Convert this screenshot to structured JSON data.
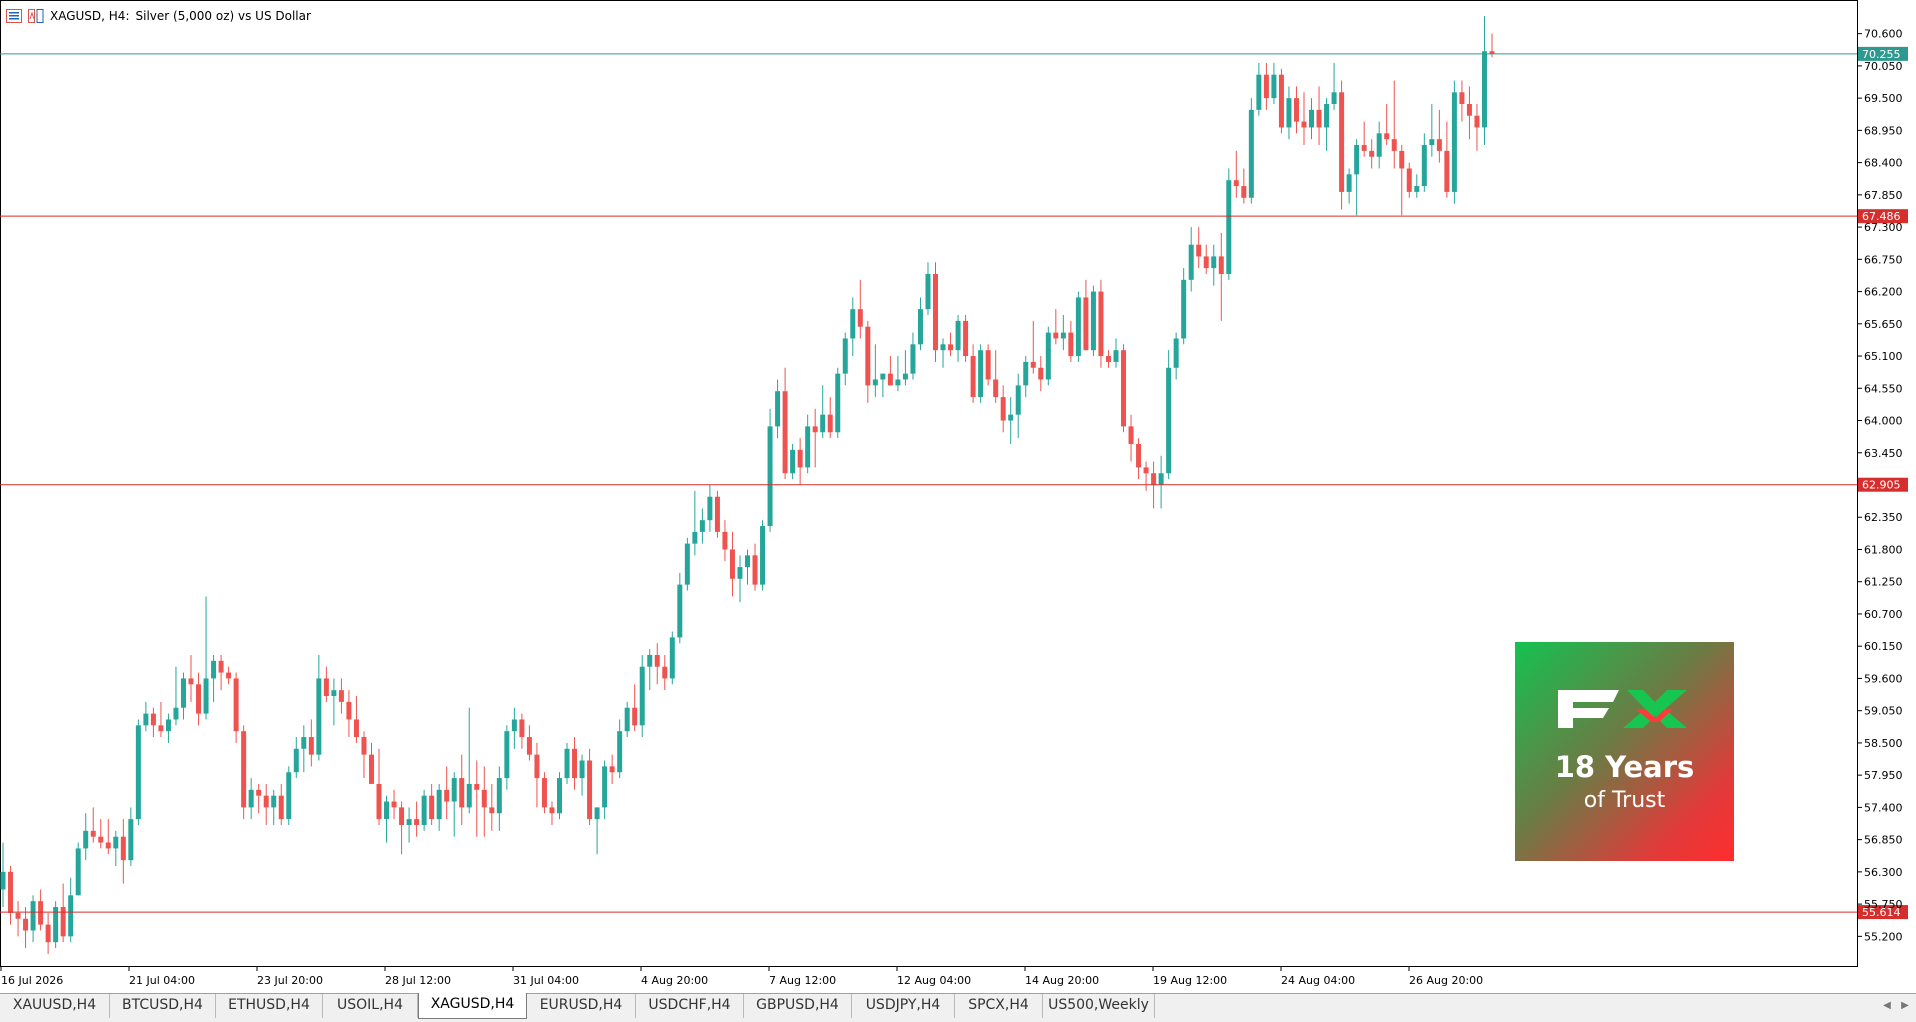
{
  "header": {
    "symbol": "XAGUSD, H4:",
    "description": "Silver (5,000 oz) vs US Dollar"
  },
  "colors": {
    "bull": "#26a69a",
    "bear": "#ef5350",
    "level": "#d62d2d",
    "current_line": "#2e9a8f"
  },
  "price_axis": {
    "ticks": [
      "70.600",
      "70.050",
      "69.500",
      "68.950",
      "68.400",
      "67.850",
      "67.300",
      "66.750",
      "66.200",
      "65.650",
      "65.100",
      "64.550",
      "64.000",
      "63.450",
      "62.350",
      "61.800",
      "61.250",
      "60.700",
      "60.150",
      "59.600",
      "59.050",
      "58.500",
      "57.950",
      "57.400",
      "56.850",
      "56.300",
      "55.750",
      "55.200"
    ]
  },
  "levels": [
    {
      "price": "67.486",
      "label": "67.486"
    },
    {
      "price": "62.905",
      "label": "62.905"
    },
    {
      "price": "55.614",
      "label": "55.614"
    }
  ],
  "current_price": "70.255",
  "time_axis": [
    "16 Jul 2026",
    "21 Jul 04:00",
    "23 Jul 20:00",
    "28 Jul 12:00",
    "31 Jul 04:00",
    "4 Aug 20:00",
    "7 Aug 12:00",
    "12 Aug 04:00",
    "14 Aug 20:00",
    "19 Aug 12:00",
    "24 Aug 04:00",
    "26 Aug 20:00"
  ],
  "logo": {
    "line1": "18 Years",
    "line2": "of Trust",
    "mark": "FX"
  },
  "tabs": [
    "XAUUSD,H4",
    "BTCUSD,H4",
    "ETHUSD,H4",
    "USOIL,H4",
    "XAGUSD,H4",
    "EURUSD,H4",
    "USDCHF,H4",
    "GBPUSD,H4",
    "USDJPY,H4",
    "SPCX,H4",
    "US500,Weekly"
  ],
  "active_tab": "XAGUSD,H4",
  "chart_data": {
    "type": "candlestick",
    "symbol": "XAGUSD",
    "timeframe": "H4",
    "ylim": [
      54.95,
      70.85
    ],
    "candles": [
      [
        56.0,
        56.8,
        55.7,
        56.3
      ],
      [
        56.3,
        56.4,
        55.4,
        55.6
      ],
      [
        55.6,
        55.8,
        55.2,
        55.5
      ],
      [
        55.5,
        55.7,
        55.0,
        55.3
      ],
      [
        55.3,
        55.9,
        55.1,
        55.8
      ],
      [
        55.8,
        56.0,
        55.3,
        55.4
      ],
      [
        55.4,
        55.6,
        54.9,
        55.1
      ],
      [
        55.1,
        55.8,
        55.0,
        55.7
      ],
      [
        55.7,
        56.1,
        55.1,
        55.2
      ],
      [
        55.2,
        56.2,
        55.1,
        55.9
      ],
      [
        55.9,
        56.8,
        55.9,
        56.7
      ],
      [
        56.7,
        57.3,
        56.5,
        57.0
      ],
      [
        57.0,
        57.4,
        56.8,
        56.9
      ],
      [
        56.9,
        57.2,
        56.7,
        56.8
      ],
      [
        56.8,
        57.2,
        56.6,
        56.7
      ],
      [
        56.7,
        57.0,
        56.4,
        56.9
      ],
      [
        56.9,
        57.2,
        56.1,
        56.5
      ],
      [
        56.5,
        57.4,
        56.4,
        57.2
      ],
      [
        57.2,
        58.9,
        57.1,
        58.8
      ],
      [
        58.8,
        59.2,
        58.7,
        59.0
      ],
      [
        59.0,
        59.1,
        58.6,
        58.8
      ],
      [
        58.8,
        59.2,
        58.6,
        58.7
      ],
      [
        58.7,
        59.0,
        58.5,
        58.9
      ],
      [
        58.9,
        59.8,
        58.8,
        59.1
      ],
      [
        59.1,
        59.7,
        58.9,
        59.6
      ],
      [
        59.6,
        60.0,
        59.2,
        59.5
      ],
      [
        59.5,
        59.7,
        58.8,
        59.0
      ],
      [
        59.0,
        61.0,
        58.9,
        59.6
      ],
      [
        59.6,
        60.0,
        59.2,
        59.9
      ],
      [
        59.9,
        60.0,
        59.4,
        59.7
      ],
      [
        59.7,
        59.8,
        59.5,
        59.6
      ],
      [
        59.6,
        59.7,
        58.5,
        58.7
      ],
      [
        58.7,
        58.8,
        57.2,
        57.4
      ],
      [
        57.4,
        57.9,
        57.2,
        57.7
      ],
      [
        57.7,
        57.8,
        57.3,
        57.6
      ],
      [
        57.6,
        57.8,
        57.1,
        57.4
      ],
      [
        57.4,
        57.7,
        57.1,
        57.6
      ],
      [
        57.6,
        57.8,
        57.1,
        57.2
      ],
      [
        57.2,
        58.1,
        57.1,
        58.0
      ],
      [
        58.0,
        58.6,
        57.9,
        58.4
      ],
      [
        58.4,
        58.8,
        58.0,
        58.6
      ],
      [
        58.6,
        58.9,
        58.1,
        58.3
      ],
      [
        58.3,
        60.0,
        58.2,
        59.6
      ],
      [
        59.6,
        59.8,
        59.2,
        59.3
      ],
      [
        59.3,
        59.6,
        58.8,
        59.4
      ],
      [
        59.4,
        59.6,
        59.0,
        59.2
      ],
      [
        59.2,
        59.4,
        58.6,
        58.9
      ],
      [
        58.9,
        59.3,
        58.5,
        58.6
      ],
      [
        58.6,
        58.7,
        57.9,
        58.3
      ],
      [
        58.3,
        58.5,
        57.9,
        57.8
      ],
      [
        57.8,
        58.4,
        57.1,
        57.2
      ],
      [
        57.2,
        57.6,
        56.8,
        57.5
      ],
      [
        57.5,
        57.7,
        57.2,
        57.4
      ],
      [
        57.4,
        57.5,
        56.6,
        57.1
      ],
      [
        57.1,
        57.4,
        56.8,
        57.2
      ],
      [
        57.2,
        57.5,
        56.9,
        57.1
      ],
      [
        57.1,
        57.7,
        57.0,
        57.6
      ],
      [
        57.6,
        57.8,
        57.1,
        57.2
      ],
      [
        57.2,
        57.8,
        57.0,
        57.7
      ],
      [
        57.7,
        58.1,
        57.2,
        57.5
      ],
      [
        57.5,
        58.0,
        56.9,
        57.9
      ],
      [
        57.9,
        58.3,
        57.1,
        57.4
      ],
      [
        57.4,
        59.1,
        57.3,
        57.8
      ],
      [
        57.8,
        58.2,
        56.9,
        57.7
      ],
      [
        57.7,
        58.1,
        56.9,
        57.4
      ],
      [
        57.4,
        57.8,
        57.0,
        57.3
      ],
      [
        57.3,
        58.1,
        57.0,
        57.9
      ],
      [
        57.9,
        58.8,
        57.7,
        58.7
      ],
      [
        58.7,
        59.1,
        58.4,
        58.9
      ],
      [
        58.9,
        59.0,
        58.4,
        58.6
      ],
      [
        58.6,
        58.8,
        58.2,
        58.3
      ],
      [
        58.3,
        58.5,
        57.4,
        57.9
      ],
      [
        57.9,
        58.0,
        57.3,
        57.4
      ],
      [
        57.4,
        57.5,
        57.1,
        57.3
      ],
      [
        57.3,
        58.0,
        57.2,
        57.9
      ],
      [
        57.9,
        58.5,
        57.8,
        58.4
      ],
      [
        58.4,
        58.6,
        57.7,
        57.9
      ],
      [
        57.9,
        58.3,
        57.6,
        58.2
      ],
      [
        58.2,
        58.4,
        57.1,
        57.2
      ],
      [
        57.2,
        57.4,
        56.6,
        57.4
      ],
      [
        57.4,
        58.2,
        57.2,
        58.1
      ],
      [
        58.1,
        58.3,
        57.8,
        58.0
      ],
      [
        58.0,
        58.9,
        57.9,
        58.7
      ],
      [
        58.7,
        59.2,
        58.6,
        59.1
      ],
      [
        59.1,
        59.5,
        58.7,
        58.8
      ],
      [
        58.8,
        60.0,
        58.6,
        59.8
      ],
      [
        59.8,
        60.1,
        59.4,
        60.0
      ],
      [
        60.0,
        60.2,
        59.5,
        59.8
      ],
      [
        59.8,
        60.0,
        59.4,
        59.6
      ],
      [
        59.6,
        60.4,
        59.5,
        60.3
      ],
      [
        60.3,
        61.4,
        60.2,
        61.2
      ],
      [
        61.2,
        62.0,
        61.1,
        61.9
      ],
      [
        61.9,
        62.8,
        61.7,
        62.1
      ],
      [
        62.1,
        62.5,
        61.9,
        62.3
      ],
      [
        62.3,
        62.9,
        62.1,
        62.7
      ],
      [
        62.7,
        62.8,
        62.0,
        62.1
      ],
      [
        62.1,
        62.3,
        61.6,
        61.8
      ],
      [
        61.8,
        62.1,
        61.0,
        61.3
      ],
      [
        61.3,
        61.7,
        60.9,
        61.5
      ],
      [
        61.5,
        61.8,
        61.2,
        61.7
      ],
      [
        61.7,
        61.9,
        61.1,
        61.2
      ],
      [
        61.2,
        62.3,
        61.1,
        62.2
      ],
      [
        62.2,
        64.2,
        62.1,
        63.9
      ],
      [
        63.9,
        64.7,
        63.7,
        64.5
      ],
      [
        64.5,
        64.9,
        63.0,
        63.1
      ],
      [
        63.1,
        63.6,
        63.0,
        63.5
      ],
      [
        63.5,
        63.7,
        62.9,
        63.2
      ],
      [
        63.2,
        64.1,
        63.1,
        63.9
      ],
      [
        63.9,
        64.2,
        63.2,
        63.8
      ],
      [
        63.8,
        64.6,
        63.7,
        64.1
      ],
      [
        64.1,
        64.4,
        63.7,
        63.8
      ],
      [
        63.8,
        64.9,
        63.7,
        64.8
      ],
      [
        64.8,
        65.5,
        64.6,
        65.4
      ],
      [
        65.4,
        66.1,
        65.1,
        65.9
      ],
      [
        65.9,
        66.4,
        65.4,
        65.6
      ],
      [
        65.6,
        65.7,
        64.3,
        64.6
      ],
      [
        64.6,
        65.3,
        64.4,
        64.7
      ],
      [
        64.7,
        64.8,
        64.4,
        64.8
      ],
      [
        64.8,
        65.1,
        64.6,
        64.6
      ],
      [
        64.6,
        65.1,
        64.5,
        64.7
      ],
      [
        64.7,
        65.2,
        64.6,
        64.8
      ],
      [
        64.8,
        65.5,
        64.7,
        65.3
      ],
      [
        65.3,
        66.1,
        65.2,
        65.9
      ],
      [
        65.9,
        66.7,
        65.8,
        66.5
      ],
      [
        66.5,
        66.7,
        65.0,
        65.2
      ],
      [
        65.2,
        65.4,
        64.9,
        65.3
      ],
      [
        65.3,
        65.5,
        65.1,
        65.2
      ],
      [
        65.2,
        65.8,
        65.0,
        65.7
      ],
      [
        65.7,
        65.8,
        65.0,
        65.1
      ],
      [
        65.1,
        65.3,
        64.3,
        64.4
      ],
      [
        64.4,
        65.3,
        64.3,
        65.2
      ],
      [
        65.2,
        65.3,
        64.6,
        64.7
      ],
      [
        64.7,
        65.2,
        64.3,
        64.4
      ],
      [
        64.4,
        64.6,
        63.8,
        64.0
      ],
      [
        64.0,
        64.4,
        63.6,
        64.1
      ],
      [
        64.1,
        64.8,
        63.7,
        64.6
      ],
      [
        64.6,
        65.1,
        64.4,
        65.0
      ],
      [
        65.0,
        65.7,
        64.8,
        64.9
      ],
      [
        64.9,
        65.1,
        64.5,
        64.7
      ],
      [
        64.7,
        65.6,
        64.6,
        65.5
      ],
      [
        65.5,
        65.9,
        65.3,
        65.4
      ],
      [
        65.4,
        65.8,
        65.2,
        65.5
      ],
      [
        65.5,
        65.7,
        65.0,
        65.1
      ],
      [
        65.1,
        66.2,
        65.0,
        66.1
      ],
      [
        66.1,
        66.4,
        65.2,
        65.2
      ],
      [
        65.2,
        66.3,
        65.1,
        66.2
      ],
      [
        66.2,
        66.4,
        64.9,
        65.1
      ],
      [
        65.1,
        65.2,
        64.9,
        65.0
      ],
      [
        65.0,
        65.4,
        64.9,
        65.2
      ],
      [
        65.2,
        65.3,
        63.8,
        63.9
      ],
      [
        63.9,
        64.1,
        63.3,
        63.6
      ],
      [
        63.6,
        63.7,
        63.0,
        63.2
      ],
      [
        63.2,
        63.3,
        62.8,
        63.1
      ],
      [
        63.1,
        63.3,
        62.5,
        62.9
      ],
      [
        62.9,
        63.4,
        62.5,
        63.1
      ],
      [
        63.1,
        65.2,
        63.0,
        64.9
      ],
      [
        64.9,
        65.5,
        64.7,
        65.4
      ],
      [
        65.4,
        66.6,
        65.3,
        66.4
      ],
      [
        66.4,
        67.3,
        66.2,
        67.0
      ],
      [
        67.0,
        67.3,
        66.6,
        66.8
      ],
      [
        66.8,
        67.0,
        66.5,
        66.6
      ],
      [
        66.6,
        67.0,
        66.3,
        66.8
      ],
      [
        66.8,
        67.2,
        65.7,
        66.5
      ],
      [
        66.5,
        68.3,
        66.4,
        68.1
      ],
      [
        68.1,
        68.6,
        67.8,
        68.0
      ],
      [
        68.0,
        68.3,
        67.7,
        67.8
      ],
      [
        67.8,
        69.5,
        67.7,
        69.3
      ],
      [
        69.3,
        70.1,
        69.2,
        69.9
      ],
      [
        69.9,
        70.1,
        69.3,
        69.5
      ],
      [
        69.5,
        70.1,
        69.4,
        69.9
      ],
      [
        69.9,
        70.0,
        68.9,
        69.0
      ],
      [
        69.0,
        69.7,
        68.8,
        69.5
      ],
      [
        69.5,
        69.7,
        68.9,
        69.1
      ],
      [
        69.1,
        69.6,
        68.7,
        69.0
      ],
      [
        69.0,
        69.5,
        68.8,
        69.3
      ],
      [
        69.3,
        69.7,
        68.7,
        69.0
      ],
      [
        69.0,
        69.5,
        68.6,
        69.4
      ],
      [
        69.4,
        70.1,
        69.3,
        69.6
      ],
      [
        69.6,
        69.8,
        67.6,
        67.9
      ],
      [
        67.9,
        68.3,
        67.7,
        68.2
      ],
      [
        68.2,
        68.8,
        67.5,
        68.7
      ],
      [
        68.7,
        69.1,
        68.5,
        68.6
      ],
      [
        68.6,
        68.8,
        68.3,
        68.5
      ],
      [
        68.5,
        69.1,
        68.3,
        68.9
      ],
      [
        68.9,
        69.4,
        68.7,
        68.8
      ],
      [
        68.8,
        69.8,
        68.3,
        68.6
      ],
      [
        68.6,
        68.7,
        67.5,
        68.3
      ],
      [
        68.3,
        68.4,
        67.8,
        67.9
      ],
      [
        67.9,
        68.2,
        67.8,
        68.0
      ],
      [
        68.0,
        68.9,
        67.9,
        68.7
      ],
      [
        68.7,
        69.4,
        68.5,
        68.8
      ],
      [
        68.8,
        69.3,
        68.4,
        68.6
      ],
      [
        68.6,
        69.1,
        67.8,
        67.9
      ],
      [
        67.9,
        69.8,
        67.7,
        69.6
      ],
      [
        69.6,
        69.8,
        69.1,
        69.4
      ],
      [
        69.4,
        69.7,
        68.8,
        69.2
      ],
      [
        69.2,
        69.4,
        68.6,
        69.0
      ],
      [
        69.0,
        70.9,
        68.7,
        70.3
      ],
      [
        70.3,
        70.6,
        70.2,
        70.255
      ]
    ]
  }
}
